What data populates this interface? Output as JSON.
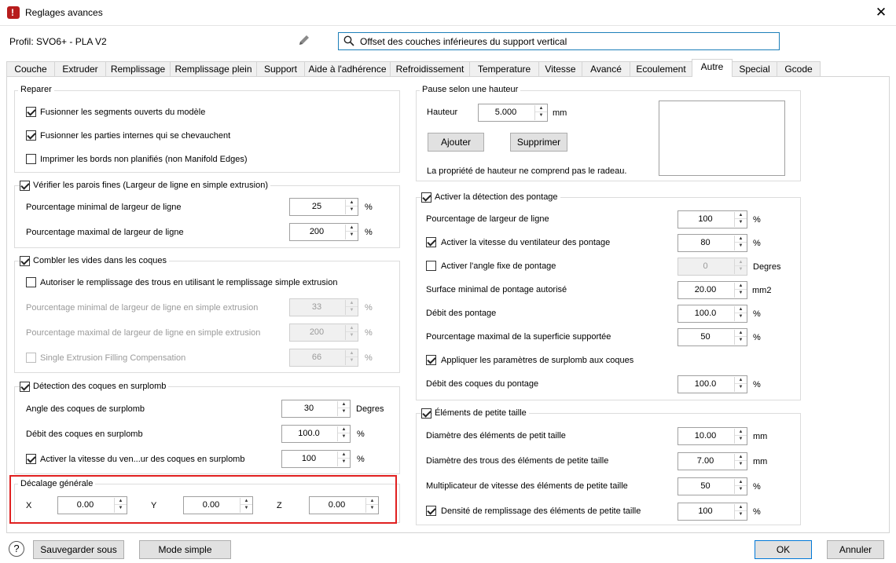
{
  "window": {
    "title": "Reglages avances",
    "close_label": "✕"
  },
  "profile": {
    "label": "Profil: SVO6+ - PLA V2"
  },
  "search": {
    "value": "Offset des couches inférieures du support vertical"
  },
  "tabs": [
    {
      "label": "Couche"
    },
    {
      "label": "Extruder"
    },
    {
      "label": "Remplissage"
    },
    {
      "label": "Remplissage plein"
    },
    {
      "label": "Support"
    },
    {
      "label": "Aide à l'adhérence"
    },
    {
      "label": "Refroidissement"
    },
    {
      "label": "Temperature"
    },
    {
      "label": "Vitesse"
    },
    {
      "label": "Avancé"
    },
    {
      "label": "Ecoulement"
    },
    {
      "label": "Autre"
    },
    {
      "label": "Special"
    },
    {
      "label": "Gcode"
    }
  ],
  "left": {
    "reparer": {
      "title": "Reparer",
      "items": [
        {
          "label": "Fusionner les segments ouverts du modèle",
          "checked": true
        },
        {
          "label": "Fusionner les parties internes qui se chevauchent",
          "checked": true
        },
        {
          "label": "Imprimer les bords non planifiés (non Manifold Edges)",
          "checked": false
        }
      ]
    },
    "parois": {
      "title": "Vérifier les parois fines (Largeur de ligne en simple extrusion)",
      "min_label": "Pourcentage minimal de largeur de ligne",
      "min_value": "25",
      "min_unit": "%",
      "max_label": "Pourcentage maximal de largeur de ligne",
      "max_value": "200",
      "max_unit": "%"
    },
    "vides": {
      "title": "Combler les vides dans les coques",
      "autoriser_label": "Autoriser le remplissage des trous en utilisant le remplissage simple extrusion",
      "min_label": "Pourcentage minimal de largeur de ligne en simple extrusion",
      "min_value": "33",
      "min_unit": "%",
      "max_label": "Pourcentage maximal de largeur de ligne en simple extrusion",
      "max_value": "200",
      "max_unit": "%",
      "comp_label": "Single Extrusion Filling Compensation",
      "comp_value": "66",
      "comp_unit": "%"
    },
    "surplomb": {
      "title": "Détection des coques en surplomb",
      "angle_label": "Angle des coques de surplomb",
      "angle_value": "30",
      "angle_unit": "Degres",
      "debit_label": "Débit des coques en surplomb",
      "debit_value": "100.0",
      "debit_unit": "%",
      "vitesse_label": "Activer la vitesse du ven...ur des coques en surplomb",
      "vitesse_value": "100",
      "vitesse_unit": "%"
    },
    "decalage": {
      "title": "Décalage générale",
      "x_label": "X",
      "x_value": "0.00",
      "y_label": "Y",
      "y_value": "0.00",
      "z_label": "Z",
      "z_value": "0.00"
    }
  },
  "right": {
    "pause": {
      "title": "Pause selon une hauteur",
      "hauteur_label": "Hauteur",
      "hauteur_value": "5.000",
      "hauteur_unit": "mm",
      "add_label": "Ajouter",
      "remove_label": "Supprimer",
      "note": "La propriété de hauteur ne comprend pas le radeau."
    },
    "pontage": {
      "title": "Activer la détection des pontage",
      "largeur_label": "Pourcentage de largeur de ligne",
      "largeur_value": "100",
      "largeur_unit": "%",
      "ventilateur_label": "Activer la vitesse du ventilateur des pontage",
      "ventilateur_value": "80",
      "ventilateur_unit": "%",
      "angle_label": "Activer l'angle fixe de pontage",
      "angle_value": "0",
      "angle_unit": "Degres",
      "surface_label": "Surface minimal de pontage autorisé",
      "surface_value": "20.00",
      "surface_unit": "mm2",
      "debit_label": "Débit des pontage",
      "debit_value": "100.0",
      "debit_unit": "%",
      "superficie_label": "Pourcentage maximal de la superficie supportée",
      "superficie_value": "50",
      "superficie_unit": "%",
      "appliquer_label": "Appliquer les paramètres de surplomb aux coques",
      "coques_label": "Débit des coques du pontage",
      "coques_value": "100.0",
      "coques_unit": "%"
    },
    "petite": {
      "title": "Éléments de petite taille",
      "diam_label": "Diamètre des éléments de petit taille",
      "diam_value": "10.00",
      "diam_unit": "mm",
      "trous_label": "Diamètre des trous des éléments de petite taille",
      "trous_value": "7.00",
      "trous_unit": "mm",
      "mult_label": "Multiplicateur de vitesse des éléments de petite taille",
      "mult_value": "50",
      "mult_unit": "%",
      "densite_label": "Densité de remplissage des éléments de petite taille",
      "densite_value": "100",
      "densite_unit": "%"
    }
  },
  "footer": {
    "help_label": "?",
    "save_as_label": "Sauvegarder sous",
    "simple_mode_label": "Mode simple",
    "ok_label": "OK",
    "cancel_label": "Annuler"
  }
}
